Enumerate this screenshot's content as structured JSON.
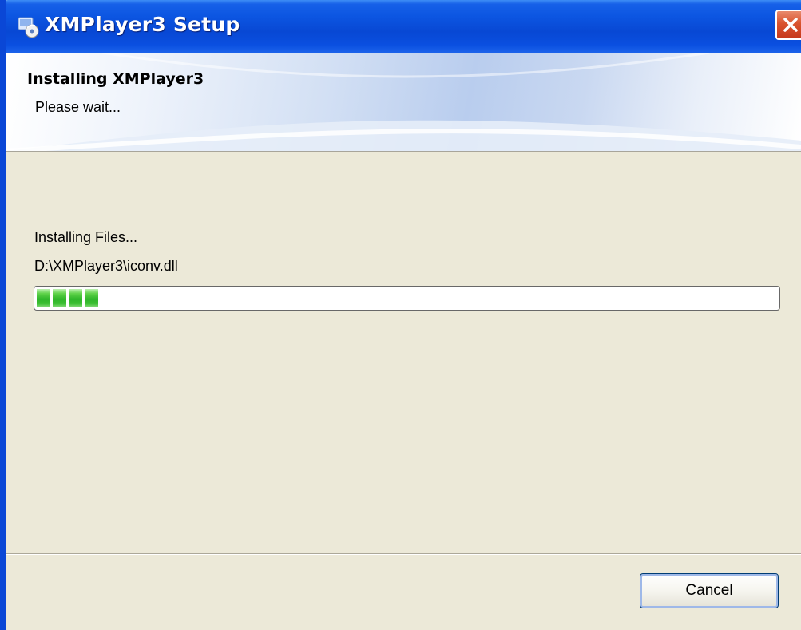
{
  "window": {
    "title": "XMPlayer3 Setup",
    "title_icon": "installer-disc-icon",
    "close_icon": "close-icon"
  },
  "header": {
    "title": "Installing XMPlayer3",
    "subtitle": "Please wait..."
  },
  "status": {
    "action": "Installing Files...",
    "file": "D:\\XMPlayer3\\iconv.dll"
  },
  "progress": {
    "percent": 8,
    "color": "#3cbf33"
  },
  "buttons": {
    "cancel_label": "Cancel"
  },
  "colors": {
    "titlebar": "#0c56e2",
    "dialog_background": "#ece9d8",
    "close_button": "#d9532e"
  }
}
